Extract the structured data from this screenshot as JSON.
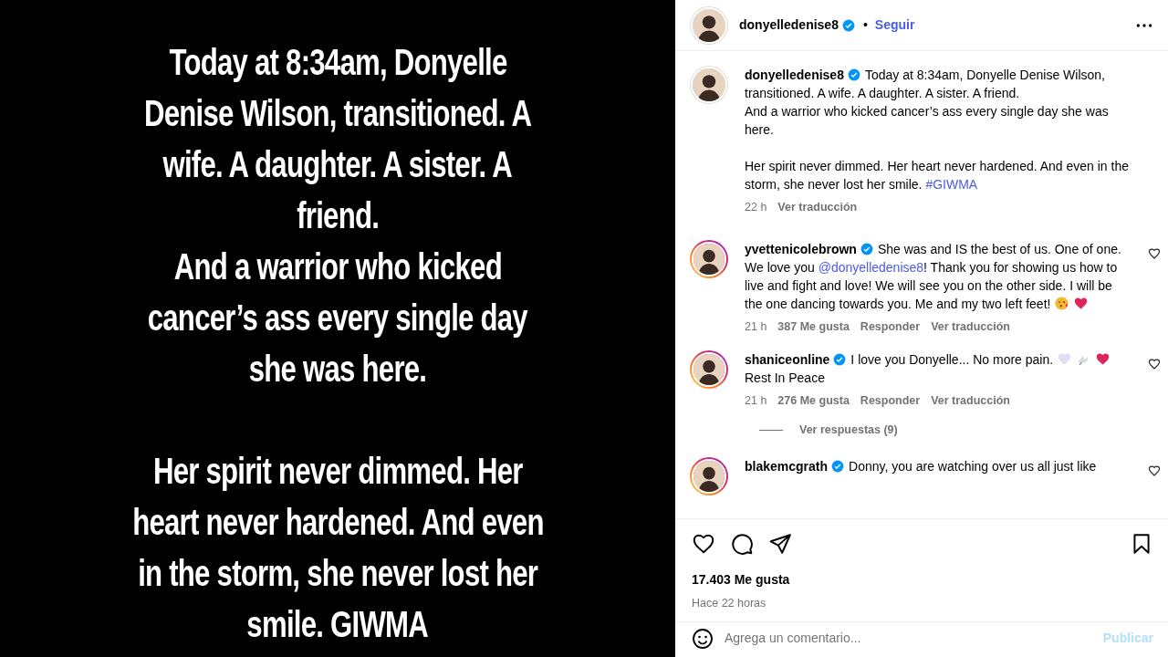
{
  "post_image": {
    "paragraphs": [
      [
        "Today at 8:34am, Donyelle",
        "Denise Wilson, transitioned. A",
        "wife. A daughter. A sister. A",
        "friend.",
        "And a warrior who kicked",
        "cancer’s ass every single day",
        "she was here."
      ],
      [
        "Her spirit never dimmed. Her",
        "heart never hardened. And even",
        "in the storm, she never lost her",
        "smile.  GIWMA"
      ]
    ]
  },
  "header": {
    "username": "donyelledenise8",
    "verified": true,
    "separator": "•",
    "follow": "Seguir"
  },
  "caption": {
    "username": "donyelledenise8",
    "verified": true,
    "story_ring": false,
    "segments": [
      {
        "kind": "text",
        "text": "Today at 8:34am, Donyelle Denise Wilson, transitioned. A wife. A daughter. A sister. A friend.\nAnd a warrior who kicked cancer’s ass every single day she was here.\n\nHer spirit never dimmed. Her heart never hardened. And even in the storm, she never lost her smile. "
      },
      {
        "kind": "hashtag",
        "text": "#GIWMA"
      }
    ],
    "time": "22 h",
    "translate": "Ver traducción"
  },
  "comments": [
    {
      "username": "yvettenicolebrown",
      "verified": true,
      "story_ring": true,
      "liked": false,
      "segments": [
        {
          "kind": "text",
          "text": "She was and IS the best of us. One of one. We love you "
        },
        {
          "kind": "mention",
          "text": "@donyelledenise8"
        },
        {
          "kind": "text",
          "text": "! Thank you for showing us how to live and fight and love! We will see you on the other side. I will be the one dancing towards you. Me and my two left feet! "
        },
        {
          "kind": "kiss-emoji"
        },
        {
          "kind": "red-heart-emoji"
        }
      ],
      "time": "21 h",
      "likes": "387 Me gusta",
      "reply": "Responder",
      "translate": "Ver traducción"
    },
    {
      "username": "shaniceonline",
      "verified": true,
      "story_ring": true,
      "liked": false,
      "segments": [
        {
          "kind": "text",
          "text": "I love you Donyelle... No more pain. "
        },
        {
          "kind": "white-heart-emoji"
        },
        {
          "kind": "dove-emoji"
        },
        {
          "kind": "red-heart-emoji"
        },
        {
          "kind": "text",
          "text": "\nRest In Peace"
        }
      ],
      "time": "21 h",
      "likes": "276 Me gusta",
      "reply": "Responder",
      "translate": "Ver traducción",
      "replies": "Ver respuestas (9)"
    },
    {
      "username": "blakemcgrath",
      "verified": true,
      "story_ring": true,
      "liked": false,
      "segments": [
        {
          "kind": "text",
          "text": "Donny, you are watching over us all just like"
        }
      ]
    }
  ],
  "actions": {
    "liked": false,
    "saved": false
  },
  "likes": "17.403 Me gusta",
  "posted": "Hace 22 horas",
  "comment_box": {
    "placeholder": "Agrega un comentario...",
    "submit": "Publicar",
    "submit_disabled": true
  }
}
